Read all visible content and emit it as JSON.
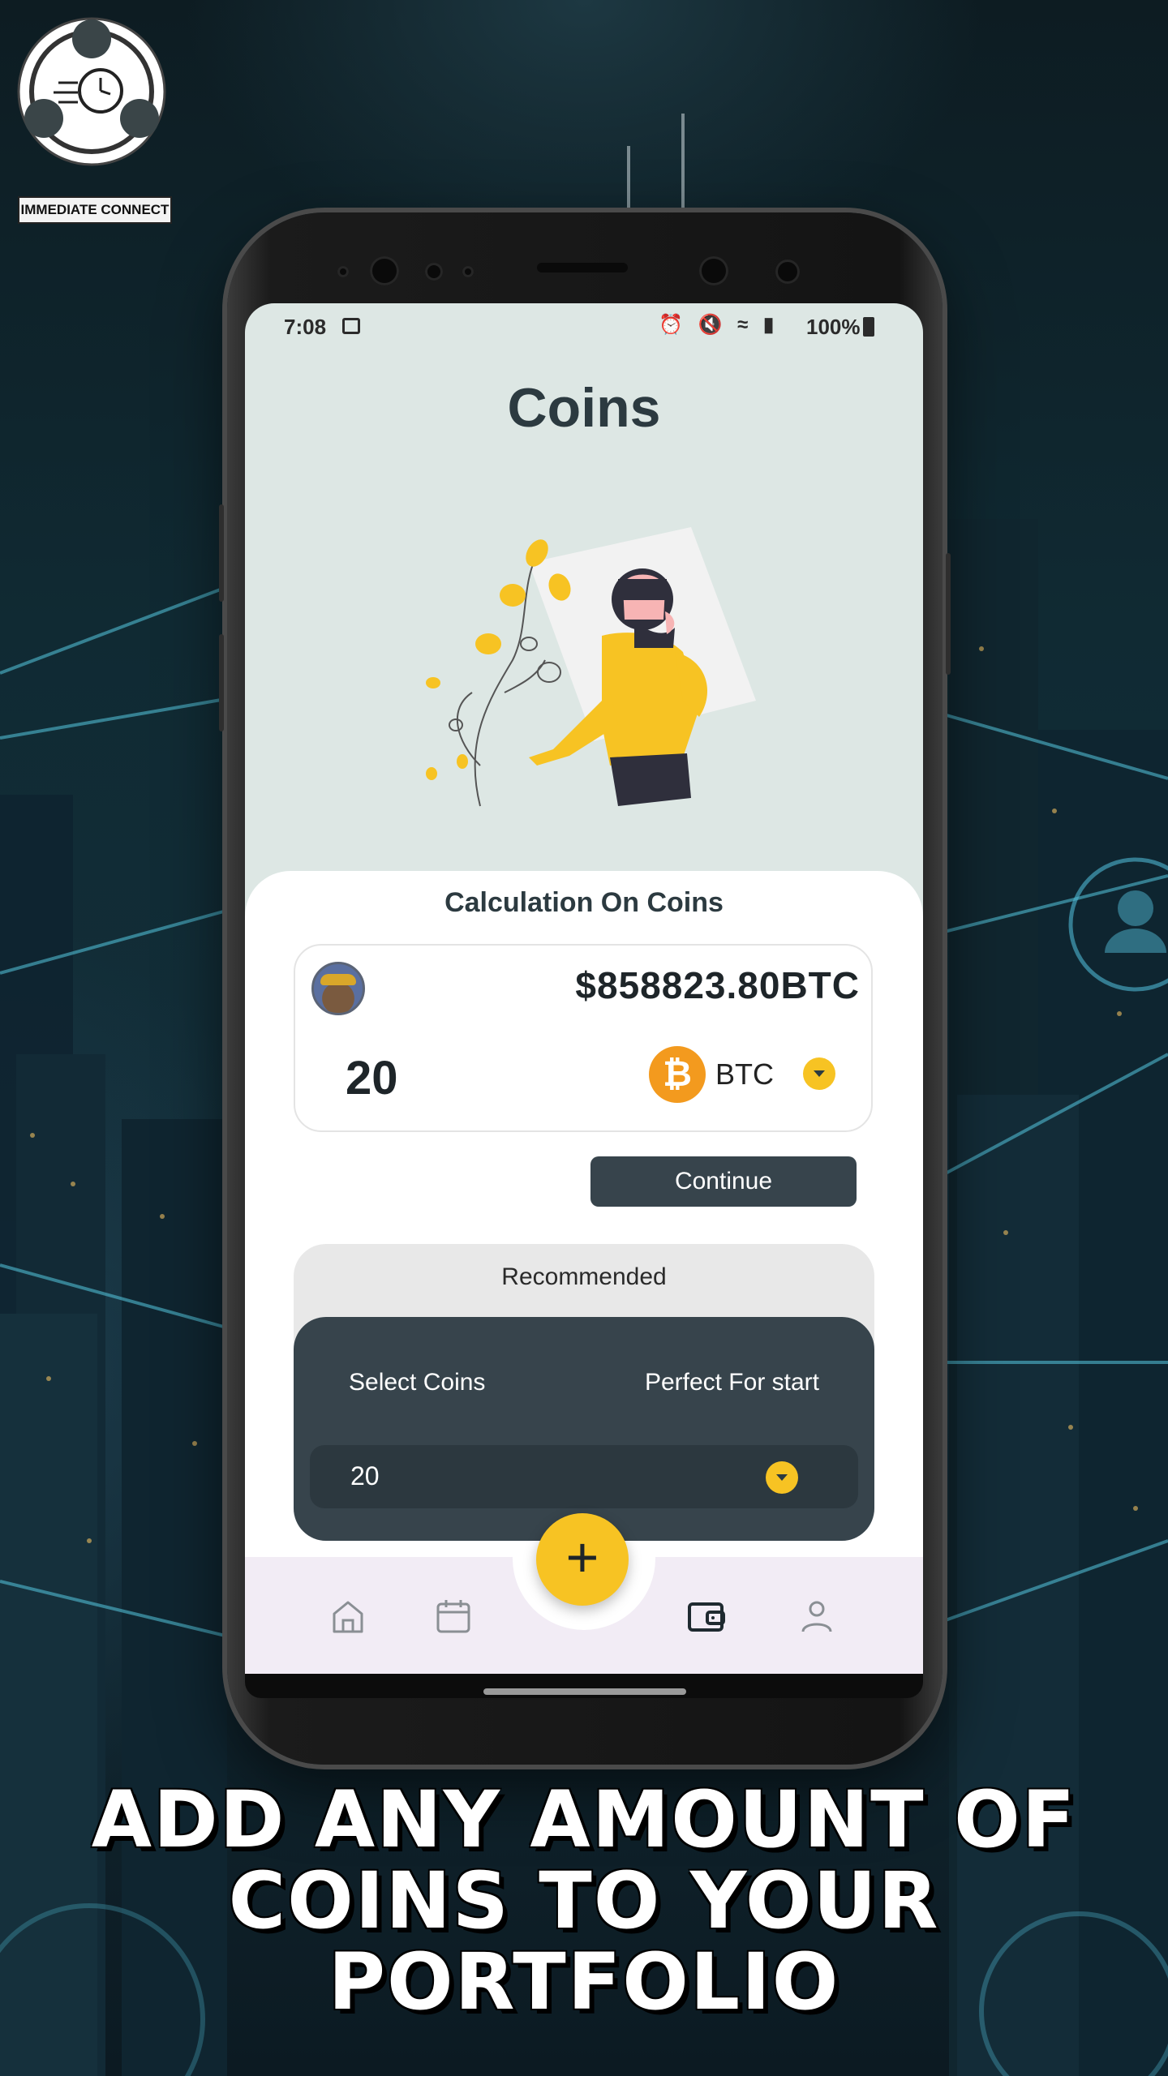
{
  "brand": {
    "name": "IMMEDIATE CONNECT"
  },
  "status_bar": {
    "time": "7:08",
    "battery": "100%"
  },
  "screen": {
    "title": "Coins",
    "calculation_title": "Calculation On Coins",
    "converter": {
      "amount_value": "$858823.80BTC",
      "coin_count": "20",
      "currency_label": "BTC",
      "currency_icon": "bitcoin-icon"
    },
    "continue_label": "Continue",
    "recommended": {
      "title": "Recommended",
      "select_coins_label": "Select Coins",
      "perfect_label": "Perfect For start",
      "select_value": "20"
    },
    "fab_label": "+",
    "nav_icons": [
      "home-icon",
      "calendar-icon",
      "wallet-icon",
      "profile-icon"
    ]
  },
  "tagline": {
    "line1": "ADD ANY AMOUNT OF",
    "line2": "COINS TO YOUR",
    "line3": "PORTFOLIO"
  },
  "colors": {
    "accent": "#f7c323",
    "dark": "#37444c",
    "screen_bg": "#dde7e4",
    "bitcoin": "#f39a1e"
  }
}
